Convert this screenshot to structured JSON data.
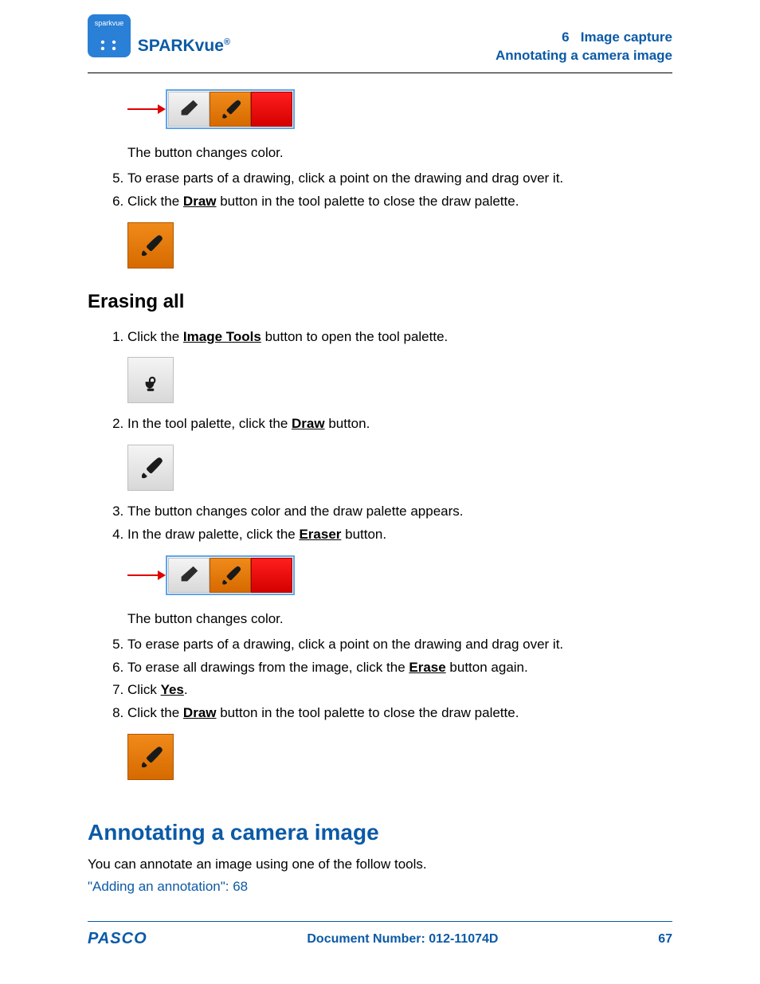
{
  "header": {
    "logo_text": "sparkvue",
    "brand": "SPARKvue",
    "brand_symbol": "®",
    "chapter_num": "6",
    "chapter_title": "Image capture",
    "section_title": "Annotating a camera image"
  },
  "block1": {
    "caption": "The button changes color.",
    "step5": "To erase parts of a drawing, click a point on the drawing and drag over it.",
    "step6_a": "Click the ",
    "step6_b": "Draw",
    "step6_c": " button in the tool palette to close the draw palette."
  },
  "erasing": {
    "heading": "Erasing all",
    "s1_a": "Click the ",
    "s1_b": "Image Tools",
    "s1_c": " button to open the tool palette.",
    "s2_a": "In the tool palette, click the ",
    "s2_b": "Draw",
    "s2_c": " button.",
    "s3": "The button changes color and the draw palette appears.",
    "s4_a": "In the draw palette, click the ",
    "s4_b": "Eraser",
    "s4_c": " button.",
    "caption4": "The button changes color.",
    "s5": "To erase parts of a drawing, click a point on the drawing and drag over it.",
    "s6_a": "To erase all drawings from the image, click the ",
    "s6_b": "Erase",
    "s6_c": " button again.",
    "s7_a": "Click ",
    "s7_b": "Yes",
    "s7_c": ".",
    "s8_a": "Click the ",
    "s8_b": "Draw",
    "s8_c": " button in the tool palette to close the draw palette."
  },
  "annotate": {
    "heading": "Annotating a camera image",
    "intro": "You can annotate an image using one of the follow tools.",
    "link_text": "\"Adding an annotation\":  68"
  },
  "footer": {
    "logo": "PASCO",
    "doc": "Document Number: 012-11074D",
    "page": "67"
  }
}
